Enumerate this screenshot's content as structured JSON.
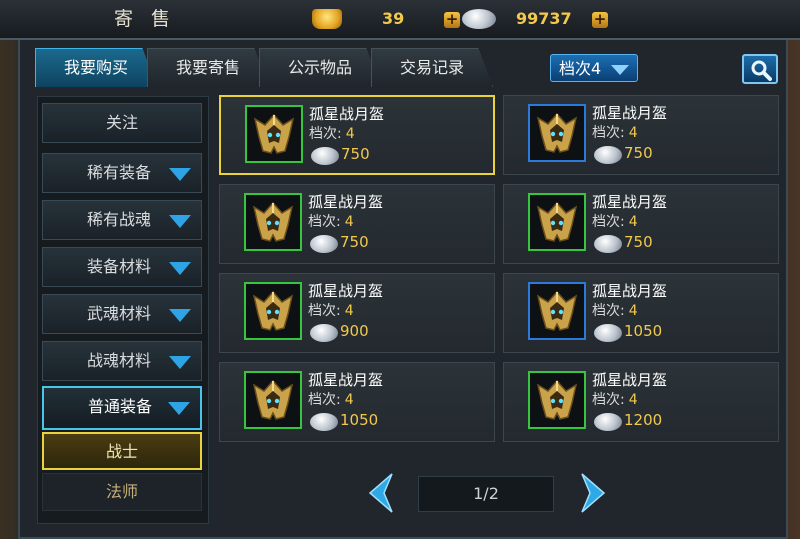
{
  "window": {
    "title": "寄 售"
  },
  "currency": {
    "gold_value": "39",
    "silver_value": "99737"
  },
  "tabs": [
    {
      "label": "我要购买",
      "active": true
    },
    {
      "label": "我要寄售",
      "active": false
    },
    {
      "label": "公示物品",
      "active": false
    },
    {
      "label": "交易记录",
      "active": false
    }
  ],
  "filter": {
    "tier_label": "档次4"
  },
  "sidebar": {
    "follow": "关注",
    "categories": [
      "稀有装备",
      "稀有战魂",
      "装备材料",
      "武魂材料",
      "战魂材料",
      "普通装备"
    ],
    "selected_category": "普通装备",
    "subcategories": [
      "战士",
      "法师"
    ],
    "selected_subcategory": "战士"
  },
  "item_tier_prefix": "档次:",
  "items": [
    {
      "name": "孤星战月盔",
      "tier": "4",
      "price": "750",
      "frame": "green",
      "highlighted": true
    },
    {
      "name": "孤星战月盔",
      "tier": "4",
      "price": "750",
      "frame": "blue",
      "highlighted": false
    },
    {
      "name": "孤星战月盔",
      "tier": "4",
      "price": "750",
      "frame": "green",
      "highlighted": false
    },
    {
      "name": "孤星战月盔",
      "tier": "4",
      "price": "750",
      "frame": "green",
      "highlighted": false
    },
    {
      "name": "孤星战月盔",
      "tier": "4",
      "price": "900",
      "frame": "green",
      "highlighted": false
    },
    {
      "name": "孤星战月盔",
      "tier": "4",
      "price": "1050",
      "frame": "blue",
      "highlighted": false
    },
    {
      "name": "孤星战月盔",
      "tier": "4",
      "price": "1050",
      "frame": "green",
      "highlighted": false
    },
    {
      "name": "孤星战月盔",
      "tier": "4",
      "price": "1200",
      "frame": "green",
      "highlighted": false
    }
  ],
  "pagination": {
    "label": "1/2"
  },
  "colors": {
    "accent": "#2ea4e6",
    "gold_text": "#f2c94c",
    "highlight": "#e8d43a",
    "frame_green": "#36c53e",
    "frame_blue": "#2b7ad9"
  }
}
